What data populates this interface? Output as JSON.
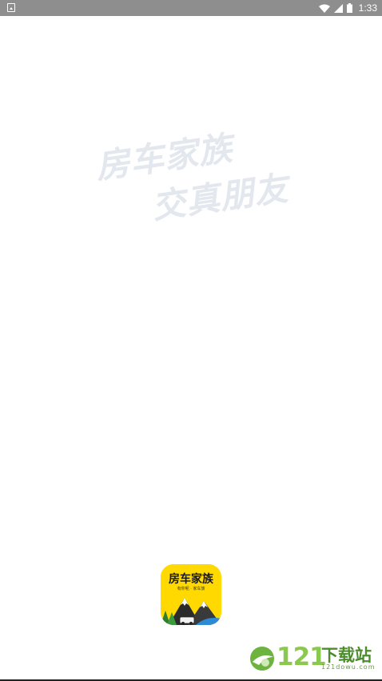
{
  "status_bar": {
    "time": "1:33",
    "icons": [
      "notification-icon",
      "wifi-icon",
      "signal-icon",
      "battery-icon"
    ]
  },
  "splash": {
    "slogan_line_1": "房车家族",
    "slogan_line_2": "交真朋友"
  },
  "app_logo": {
    "title": "房车家族",
    "subtitle": "有你呢 · 家车旅"
  },
  "watermark": {
    "number": "121",
    "text": "下载站",
    "url": "121dowu.com"
  },
  "colors": {
    "status_bar": "#8e8e8e",
    "slogan": "#e3e7ee",
    "logo_bg": "#ffd900",
    "watermark_green": "#8bc94e"
  }
}
